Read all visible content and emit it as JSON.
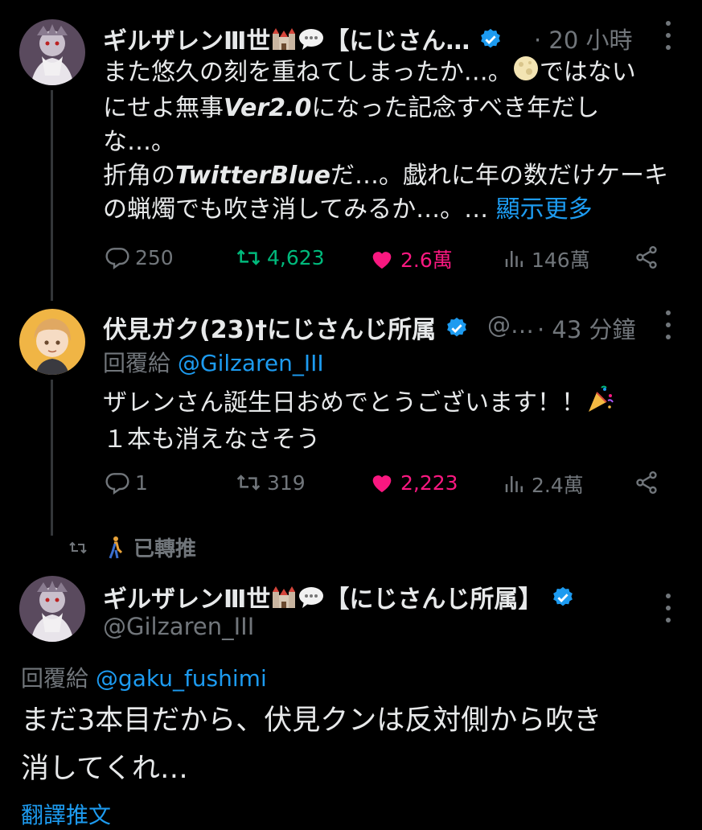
{
  "tweet1": {
    "name": "ギルザレンⅢ世",
    "name_tail": "【にじさん…",
    "time": "· 20 小時",
    "line1": "また悠久の刻を重ねてしまったか…。",
    "line1b": "ではない",
    "line2a": "にせよ無事",
    "line2b": "Ver2.0",
    "line2c": "になった記念すべき年だし",
    "line3": "な…。",
    "line4a": "折角の",
    "line4b": "TwitterBlue",
    "line4c": "だ…。戯れに年の数だけケーキ",
    "line5": "の蝋燭でも吹き消してみるか…。…",
    "show_more": "顯示更多",
    "replies": "250",
    "retweets": "4,623",
    "likes": "2.6萬",
    "views": "146萬"
  },
  "tweet2": {
    "name": "伏見ガク(23)†にじさんじ所属",
    "handle": "@…",
    "time": "· 43 分鐘",
    "reply_prefix": "回覆給",
    "reply_handle": "@Gilzaren_III",
    "line1": "ザレンさん誕生日おめでとうございます！！",
    "line2": "１本も消えなさそう",
    "replies": "1",
    "retweets": "319",
    "likes": "2,223",
    "views": "2.4萬"
  },
  "retweet_label": "已轉推",
  "tweet3": {
    "name": "ギルザレンⅢ世",
    "name_tail": "【にじさんじ所属】",
    "handle": "@Gilzaren_III",
    "reply_prefix": "回覆給",
    "reply_handle": "@gaku_fushimi",
    "line1": "まだ3本目だから、伏見クンは反対側から吹き",
    "line2": "消してくれ…",
    "translate": "翻譯推文"
  },
  "colors": {
    "background": "#000000",
    "text": "#e7e9ea",
    "muted": "#71767b",
    "link": "#1d9bf0",
    "retweet": "#00ba7c",
    "like": "#f91880"
  }
}
